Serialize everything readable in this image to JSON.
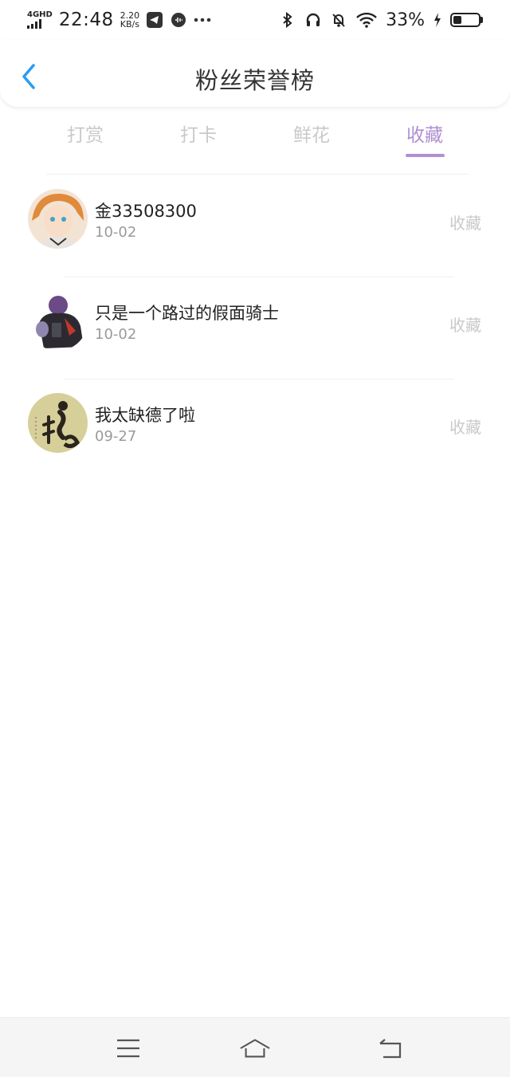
{
  "status_bar": {
    "network": "4GHD",
    "time": "22:48",
    "speed_value": "2.20",
    "speed_unit": "KB/s",
    "battery": "33%",
    "battery_level": 0.33
  },
  "header": {
    "title": "粉丝荣誉榜"
  },
  "tabs": [
    {
      "label": "打赏",
      "active": false
    },
    {
      "label": "打卡",
      "active": false
    },
    {
      "label": "鲜花",
      "active": false
    },
    {
      "label": "收藏",
      "active": true
    }
  ],
  "rows": [
    {
      "name": "金33508300",
      "date": "10-02",
      "action": "收藏"
    },
    {
      "name": "只是一个路过的假面骑士",
      "date": "10-02",
      "action": "收藏"
    },
    {
      "name": "我太缺德了啦",
      "date": "09-27",
      "action": "收藏"
    }
  ],
  "colors": {
    "accent": "#b08fd3",
    "back": "#2a9df4",
    "muted": "#c9c9c9"
  },
  "icons": [
    "back-arrow-icon",
    "bluetooth-icon",
    "headphones-icon",
    "mute-bell-icon",
    "wifi-icon",
    "charging-icon",
    "battery-icon",
    "menu-icon",
    "home-icon",
    "return-icon"
  ]
}
